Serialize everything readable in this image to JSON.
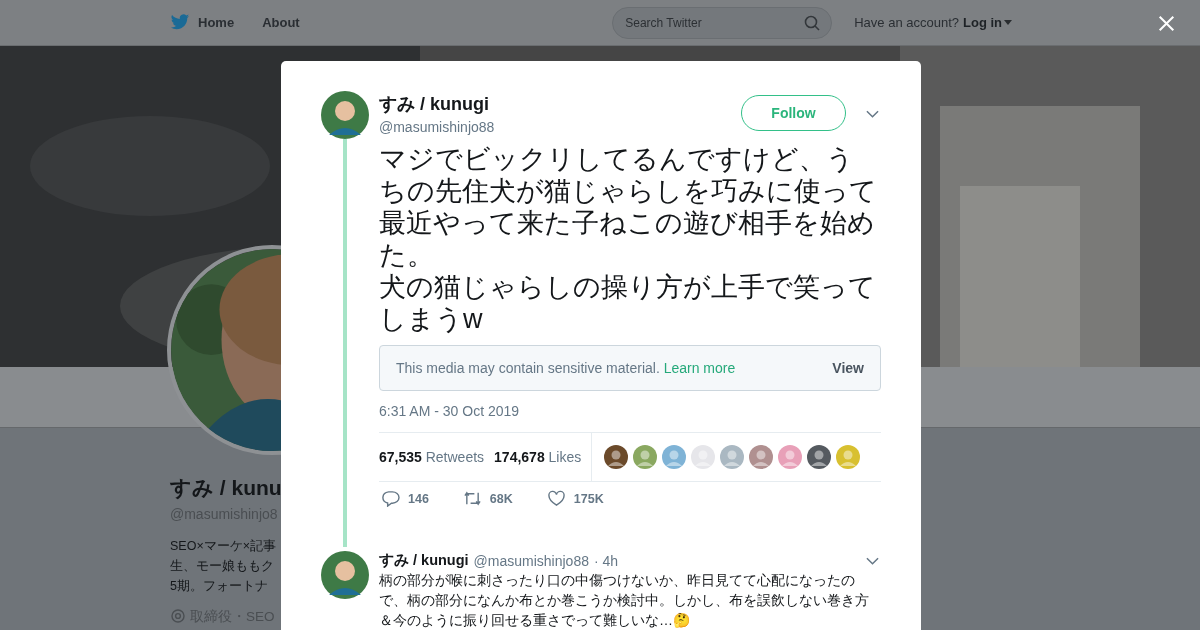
{
  "header": {
    "nav": [
      {
        "label": "Home",
        "selected": false
      },
      {
        "label": "About",
        "selected": false
      }
    ],
    "search": {
      "placeholder": "Search Twitter"
    },
    "account_prompt": "Have an account?",
    "login": "Log in"
  },
  "profile": {
    "name": "すみ / kunu",
    "handle": "@masumishinjo8",
    "bio": [
      "SEO×マーケ×記事",
      "生、モー娘ももク",
      "5期。フォートナ"
    ],
    "location": "取締役・SEO"
  },
  "tweet": {
    "name": "すみ / kunugi",
    "handle": "@masumishinjo88",
    "follow": "Follow",
    "text": [
      "マジでビックリしてるんですけど、うちの先住犬が猫じゃらしを巧みに使って最近やって来た子ねこの遊び相手を始めた。",
      "犬の猫じゃらしの操り方が上手で笑ってしまうw"
    ],
    "sensitive": {
      "message": "This media may contain sensitive material.",
      "link": "Learn more",
      "action": "View"
    },
    "time": "6:31 AM - 30 Oct 2019",
    "retweets": {
      "count": "67,535",
      "label": "Retweets"
    },
    "likes": {
      "count": "174,678",
      "label": "Likes"
    },
    "liker_avatars": [
      {
        "kind": "picture"
      },
      {
        "kind": "picture"
      },
      {
        "kind": "picture"
      },
      {
        "kind": "picture"
      },
      {
        "kind": "picture"
      },
      {
        "kind": "picture"
      },
      {
        "kind": "picture"
      },
      {
        "kind": "picture"
      },
      {
        "kind": "picture"
      }
    ],
    "actions": [
      {
        "kind": "reply",
        "count": "146"
      },
      {
        "kind": "retweet",
        "count": "68K"
      },
      {
        "kind": "like",
        "count": "175K"
      }
    ]
  },
  "reply": {
    "name": "すみ / kunugi",
    "handle": "@masumishinjo88",
    "time": "· 4h",
    "text": "柄の部分が喉に刺さったり口の中傷つけないか、昨日見てて心配になったので、柄の部分になんか布とか巻こうか検討中。しかし、布を誤飲しない巻き方＆今のように振り回せる重さでって難しいな…🤔"
  }
}
